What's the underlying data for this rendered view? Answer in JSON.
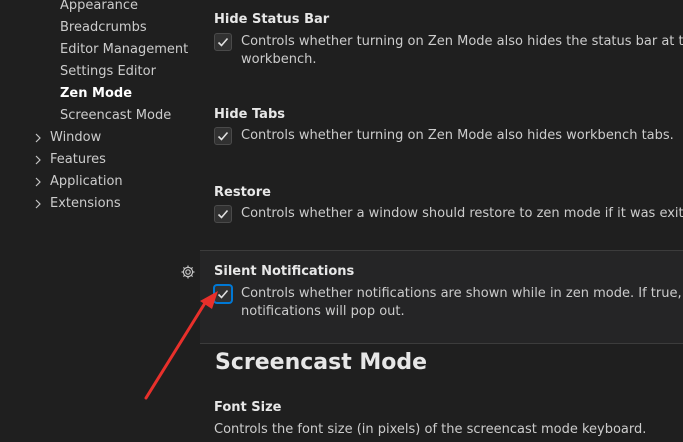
{
  "sidebar": {
    "sub_items": [
      {
        "label": "Appearance"
      },
      {
        "label": "Breadcrumbs"
      },
      {
        "label": "Editor Management"
      },
      {
        "label": "Settings Editor"
      },
      {
        "label": "Zen Mode",
        "active": true
      },
      {
        "label": "Screencast Mode"
      }
    ],
    "top_items": [
      {
        "label": "Window"
      },
      {
        "label": "Features"
      },
      {
        "label": "Application"
      },
      {
        "label": "Extensions"
      }
    ]
  },
  "settings": [
    {
      "title": "Hide Status Bar",
      "checked": true,
      "desc_line1": "Controls whether turning on Zen Mode also hides the status bar at the bottom of the",
      "desc_line2": "workbench."
    },
    {
      "title": "Hide Tabs",
      "checked": true,
      "desc_line1": "Controls whether turning on Zen Mode also hides workbench tabs."
    },
    {
      "title": "Restore",
      "checked": true,
      "desc_line1": "Controls whether a window should restore to zen mode if it was exited in zen mode."
    },
    {
      "title": "Silent Notifications",
      "checked": true,
      "focused": true,
      "desc_line1": "Controls whether notifications are shown while in zen mode. If true, only error",
      "desc_line2": "notifications will pop out."
    }
  ],
  "section": {
    "heading": "Screencast Mode",
    "font_size_title": "Font Size",
    "font_size_desc": "Controls the font size (in pixels) of the screencast mode keyboard."
  },
  "icons": {
    "gear": "gear-icon",
    "chevron": "chevron-right-icon",
    "check": "check-icon"
  },
  "colors": {
    "background": "#1f1f1f",
    "focused_row": "#252526",
    "focus_border": "#0078d4",
    "annotation_arrow": "#e8302b"
  }
}
